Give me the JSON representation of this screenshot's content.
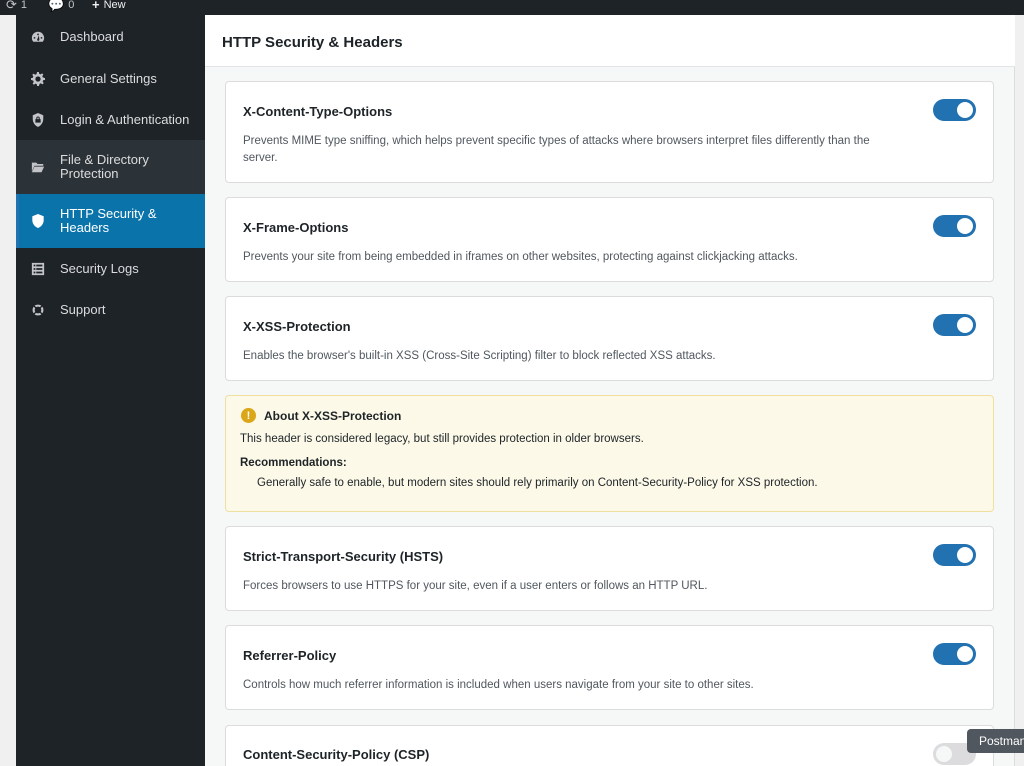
{
  "adminbar": {
    "updates_count": "1",
    "comments_count": "0",
    "new_label": "New"
  },
  "sidebar": {
    "items": [
      {
        "label": "Dashboard",
        "icon": "dashboard-icon"
      },
      {
        "label": "General Settings",
        "icon": "gear-icon"
      },
      {
        "label": "Login & Authentication",
        "icon": "lock-shield-icon"
      },
      {
        "label": "File & Directory Protection",
        "icon": "folder-icon"
      },
      {
        "label": "HTTP Security & Headers",
        "icon": "shield-icon",
        "active": true
      },
      {
        "label": "Security Logs",
        "icon": "list-icon"
      },
      {
        "label": "Support",
        "icon": "lifebuoy-icon"
      }
    ]
  },
  "header": {
    "title": "HTTP Security & Headers"
  },
  "settings": [
    {
      "title": "X-Content-Type-Options",
      "description": "Prevents MIME type sniffing, which helps prevent specific types of attacks where browsers interpret files differently than the server.",
      "enabled": true
    },
    {
      "title": "X-Frame-Options",
      "description": "Prevents your site from being embedded in iframes on other websites, protecting against clickjacking attacks.",
      "enabled": true
    },
    {
      "title": "X-XSS-Protection",
      "description": "Enables the browser's built-in XSS (Cross-Site Scripting) filter to block reflected XSS attacks.",
      "enabled": true
    },
    {
      "title": "Strict-Transport-Security (HSTS)",
      "description": "Forces browsers to use HTTPS for your site, even if a user enters or follows an HTTP URL.",
      "enabled": true
    },
    {
      "title": "Referrer-Policy",
      "description": "Controls how much referrer information is included when users navigate from your site to other sites.",
      "enabled": true
    },
    {
      "title": "Content-Security-Policy (CSP)",
      "description": "",
      "enabled": false
    }
  ],
  "notice": {
    "icon": "warning-icon",
    "title": "About X-XSS-Protection",
    "text": "This header is considered legacy, but still provides protection in older browsers.",
    "recommendations_label": "Recommendations:",
    "recommendations_text": "Generally safe to enable, but modern sites should rely primarily on Content-Security-Policy for XSS protection."
  },
  "tooltip": {
    "text": "Postman"
  },
  "colors": {
    "sidebar_bg": "#1d2327",
    "active_item": "#0a73aa",
    "toggle_on": "#2271b1",
    "notice_bg": "#fcf9e8"
  }
}
